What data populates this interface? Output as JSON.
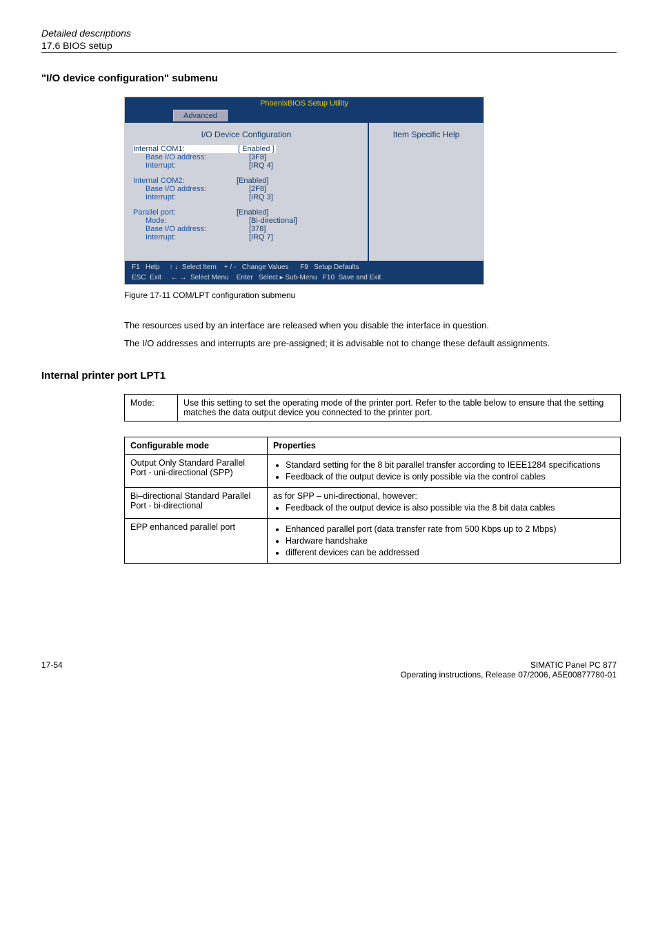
{
  "header": {
    "italic": "Detailed descriptions",
    "section": "17.6 BIOS setup"
  },
  "heading1": "\"I/O device configuration\" submenu",
  "bios": {
    "title": "PhoenixBIOS Setup Utility",
    "tab": "Advanced",
    "subhead": "I/O Device Configuration",
    "help_heading": "Item Specific Help",
    "com1": {
      "label": "Internal COM1:",
      "enabled": "[ Enabled ]",
      "io_label": "Base I/O address:",
      "io": "[3F8]",
      "irq_label": "Interrupt:",
      "irq": "[IRQ 4]"
    },
    "com2": {
      "label": "Internal COM2:",
      "enabled": "[Enabled]",
      "io_label": "Base I/O address:",
      "io": "[2F8]",
      "irq_label": "Interrupt:",
      "irq": "[IRQ 3]"
    },
    "lpt": {
      "label": "Parallel port:",
      "enabled": "[Enabled]",
      "mode_label": "Mode:",
      "mode": "[Bi-directional]",
      "io_label": "Base I/O address:",
      "io": "[378]",
      "irq_label": "Interrupt:",
      "irq": "[IRQ 7]"
    },
    "footer": {
      "left": "F1   Help     ↑ ↓  Select Item    + / -   Change Values      F9   Setup Defaults",
      "right": "ESC  Exit     ← →  Select Menu    Enter   Select ▸ Sub-Menu   F10  Save and Exit"
    }
  },
  "figure_caption": "Figure 17-11  COM/LPT configuration submenu",
  "para1": "The resources used by an interface are released when you disable the interface in question.",
  "para2": "The I/O addresses and interrupts are pre-assigned; it is advisable not to change these default assignments.",
  "heading2": "Internal printer port LPT1",
  "mode_table": {
    "label": "Mode:",
    "text": "Use this setting to set the operating mode of the printer port. Refer to the table below to ensure that the setting matches the data output device you connected to the printer port."
  },
  "modes_table": {
    "head1": "Configurable mode",
    "head2": "Properties",
    "rows": [
      {
        "mode": "Output Only Standard Parallel Port - uni-directional (SPP)",
        "props": [
          "Standard setting for the 8 bit parallel transfer according to IEEE1284 specifications",
          "Feedback of the output device is only possible via the control cables"
        ]
      },
      {
        "mode": "Bi–directional Standard Parallel Port - bi-directional",
        "intro": "as for SPP – uni-directional, however:",
        "props": [
          "Feedback of the output device is also possible via the 8 bit data cables"
        ]
      },
      {
        "mode": "EPP enhanced parallel port",
        "props": [
          "Enhanced parallel port (data transfer rate from 500 Kbps up to 2 Mbps)",
          "Hardware handshake",
          "different devices can be addressed"
        ]
      }
    ]
  },
  "footer": {
    "page": "17-54",
    "product": "SIMATIC Panel PC 877",
    "doc": "Operating instructions, Release 07/2006, A5E00877780-01"
  }
}
